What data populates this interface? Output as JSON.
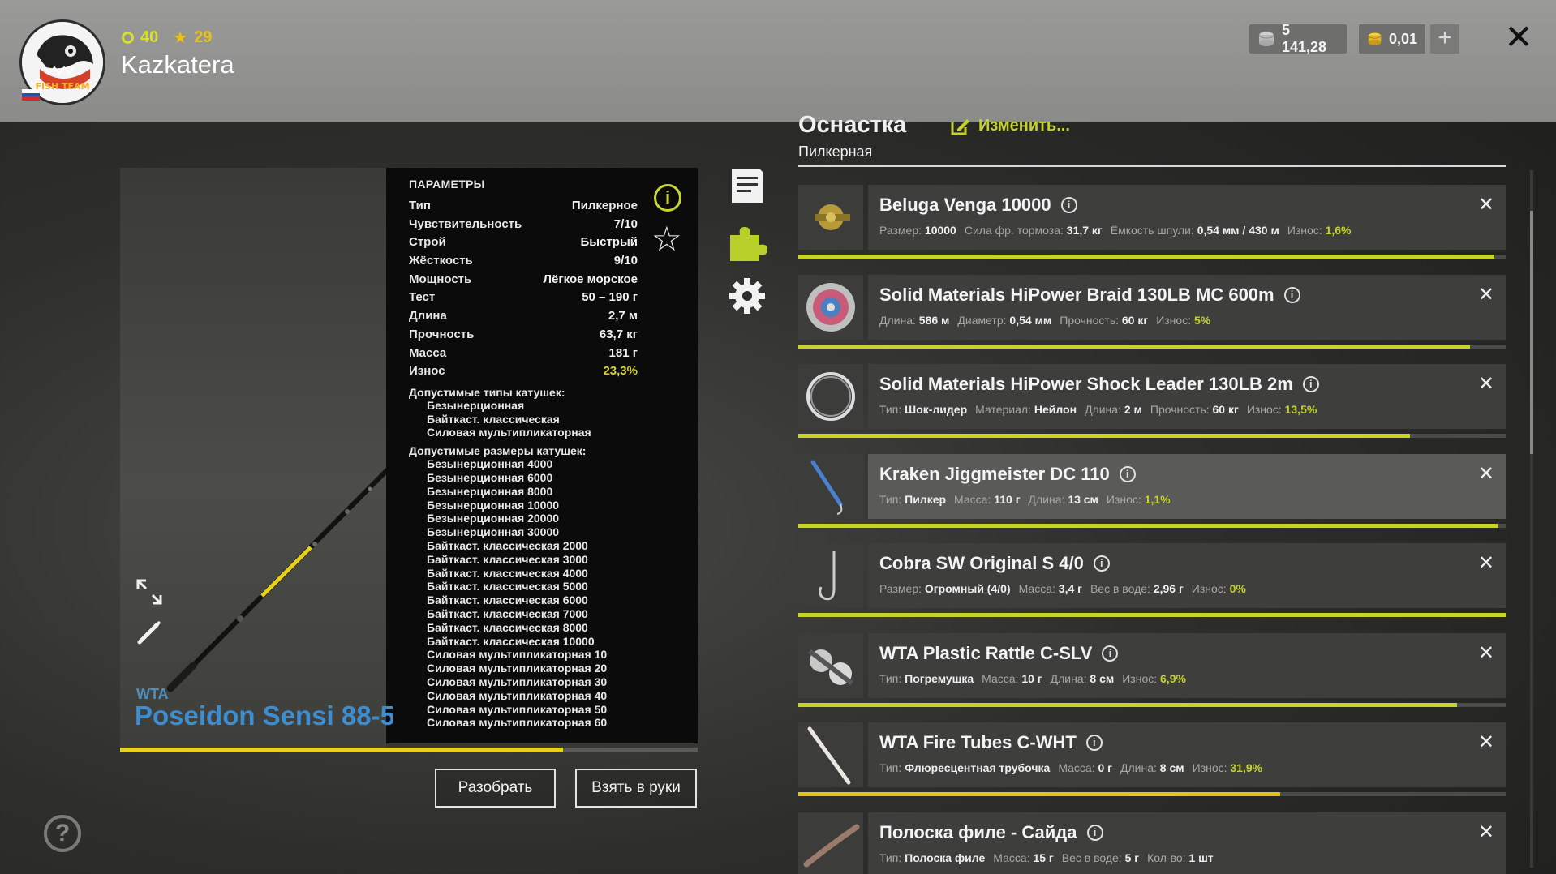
{
  "header": {
    "username": "Kazkatera",
    "level": "40",
    "stars": "29",
    "silver": "5 141,28",
    "gold": "0,01",
    "avatar_text": "FISH TEAM"
  },
  "rod": {
    "brand": "WTA",
    "name": "Poseidon Sensi 88-5",
    "wear_fraction": 0.767,
    "params_title": "ПАРАМЕТРЫ",
    "params": [
      {
        "k": "Тип",
        "v": "Пилкерное"
      },
      {
        "k": "Чувствительность",
        "v": "7/10"
      },
      {
        "k": "Строй",
        "v": "Быстрый"
      },
      {
        "k": "Жёсткость",
        "v": "9/10"
      },
      {
        "k": "Мощность",
        "v": "Лёгкое морское"
      },
      {
        "k": "Тест",
        "v": "50 – 190 г"
      },
      {
        "k": "Длина",
        "v": "2,7 м"
      },
      {
        "k": "Прочность",
        "v": "63,7 кг"
      },
      {
        "k": "Масса",
        "v": "181 г"
      },
      {
        "k": "Износ",
        "v": "23,3%"
      }
    ],
    "reel_types_label": "Допустимые типы катушек:",
    "reel_types": [
      "Безынерционная",
      "Байткаст. классическая",
      "Силовая мультипликаторная"
    ],
    "reel_sizes_label": "Допустимые размеры катушек:",
    "reel_sizes": [
      "Безынерционная 4000",
      "Безынерционная 6000",
      "Безынерционная 8000",
      "Безынерционная 10000",
      "Безынерционная 20000",
      "Безынерционная 30000",
      "Байткаст. классическая 2000",
      "Байткаст. классическая 3000",
      "Байткаст. классическая 4000",
      "Байткаст. классическая 5000",
      "Байткаст. классическая 6000",
      "Байткаст. классическая 7000",
      "Байткаст. классическая 8000",
      "Байткаст. классическая 10000",
      "Силовая мультипликаторная 10",
      "Силовая мультипликаторная 20",
      "Силовая мультипликаторная 30",
      "Силовая мультипликаторная 40",
      "Силовая мультипликаторная 50",
      "Силовая мультипликаторная 60"
    ]
  },
  "buttons": {
    "disassemble": "Разобрать",
    "take": "Взять в руки"
  },
  "tackle": {
    "title": "Оснастка",
    "edit": "Изменить...",
    "subtitle": "Пилкерная",
    "items": [
      {
        "name": "Beluga Venga 10000",
        "stats": [
          [
            "Размер:",
            "10000"
          ],
          [
            "Сила фр. тормоза:",
            "31,7 кг"
          ],
          [
            "Ёмкость шпули:",
            "0,54 мм / 430 м"
          ]
        ],
        "wear_label": "Износ:",
        "wear": "1,6%",
        "bar": 0.984,
        "bar_color": "green",
        "selected": false
      },
      {
        "name": "Solid Materials HiPower Braid 130LB MC 600m",
        "stats": [
          [
            "Длина:",
            "586 м"
          ],
          [
            "Диаметр:",
            "0,54 мм"
          ],
          [
            "Прочность:",
            "60 кг"
          ]
        ],
        "wear_label": "Износ:",
        "wear": "5%",
        "bar": 0.95,
        "bar_color": "green",
        "selected": false
      },
      {
        "name": "Solid Materials HiPower Shock Leader 130LB 2m",
        "stats": [
          [
            "Тип:",
            "Шок-лидер"
          ],
          [
            "Материал:",
            "Нейлон"
          ],
          [
            "Длина:",
            "2 м"
          ],
          [
            "Прочность:",
            "60 кг"
          ]
        ],
        "wear_label": "Износ:",
        "wear": "13,5%",
        "bar": 0.865,
        "bar_color": "green",
        "selected": false
      },
      {
        "name": "Kraken Jiggmeister DC 110",
        "stats": [
          [
            "Тип:",
            "Пилкер"
          ],
          [
            "Масса:",
            "110 г"
          ],
          [
            "Длина:",
            "13 см"
          ]
        ],
        "wear_label": "Износ:",
        "wear": "1,1%",
        "bar": 0.989,
        "bar_color": "green",
        "selected": true
      },
      {
        "name": "Cobra SW Original S 4/0",
        "stats": [
          [
            "Размер:",
            "Огромный (4/0)"
          ],
          [
            "Масса:",
            "3,4 г"
          ],
          [
            "Вес в воде:",
            "2,96 г"
          ]
        ],
        "wear_label": "Износ:",
        "wear": "0%",
        "bar": 1.0,
        "bar_color": "green",
        "selected": false
      },
      {
        "name": "WTA Plastic Rattle C-SLV",
        "stats": [
          [
            "Тип:",
            "Погремушка"
          ],
          [
            "Масса:",
            "10 г"
          ],
          [
            "Длина:",
            "8 см"
          ]
        ],
        "wear_label": "Износ:",
        "wear": "6,9%",
        "bar": 0.931,
        "bar_color": "green",
        "selected": false
      },
      {
        "name": "WTA Fire Tubes C-WHT",
        "stats": [
          [
            "Тип:",
            "Флюресцентная трубочка"
          ],
          [
            "Масса:",
            "0 г"
          ],
          [
            "Длина:",
            "8 см"
          ]
        ],
        "wear_label": "Износ:",
        "wear": "31,9%",
        "bar": 0.681,
        "bar_color": "yellow",
        "selected": false
      },
      {
        "name": "Полоска филе - Сайда",
        "stats": [
          [
            "Тип:",
            "Полоска филе"
          ],
          [
            "Масса:",
            "15 г"
          ],
          [
            "Вес в воде:",
            "5 г"
          ],
          [
            "Кол-во:",
            "1 шт"
          ]
        ],
        "wear_label": "",
        "wear": "",
        "bar": 0,
        "bar_color": "green",
        "selected": false
      }
    ]
  },
  "colors": {
    "accent_green": "#c6d428",
    "accent_yellow": "#e6c21a",
    "rod_name_blue": "#3d8ed1"
  },
  "icons": [
    "close-icon",
    "plus-icon",
    "silver-coin-icon",
    "gold-coin-icon",
    "info-icon",
    "star-icon",
    "document-icon",
    "puzzle-icon",
    "gear-icon",
    "edit-icon",
    "expand-icon",
    "brush-icon",
    "help-icon"
  ]
}
